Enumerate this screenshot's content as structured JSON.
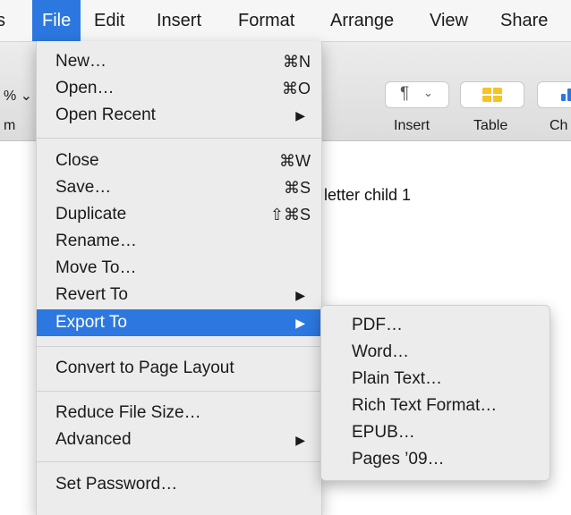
{
  "menubar": {
    "items": [
      "s",
      "File",
      "Edit",
      "Insert",
      "Format",
      "Arrange",
      "View",
      "Share"
    ],
    "active": "File"
  },
  "toolbar": {
    "left_fragment": "% ⌄",
    "left_label": "m",
    "insert_label": "Insert",
    "table_label": "Table",
    "chart_label": "Ch",
    "insert_icon": "¶",
    "insert_chevron": "⌄"
  },
  "document": {
    "text_fragment": "ı letter child 1"
  },
  "file_menu": {
    "items": [
      {
        "label": "New…",
        "shortcut": "⌘N"
      },
      {
        "label": "Open…",
        "shortcut": "⌘O"
      },
      {
        "label": "Open Recent",
        "submenu_arrow": "▶"
      },
      {
        "label": "Close",
        "shortcut": "⌘W"
      },
      {
        "label": "Save…",
        "shortcut": "⌘S"
      },
      {
        "label": "Duplicate",
        "shortcut": "⇧⌘S"
      },
      {
        "label": "Rename…"
      },
      {
        "label": "Move To…"
      },
      {
        "label": "Revert To",
        "submenu_arrow": "▶"
      },
      {
        "label": "Export To",
        "submenu_arrow": "▶",
        "highlighted": true
      },
      {
        "label": "Convert to Page Layout"
      },
      {
        "label": "Reduce File Size…"
      },
      {
        "label": "Advanced",
        "submenu_arrow": "▶"
      },
      {
        "label": "Set Password…"
      }
    ]
  },
  "export_submenu": {
    "items": [
      "PDF…",
      "Word…",
      "Plain Text…",
      "Rich Text Format…",
      "EPUB…",
      "Pages ’09…"
    ]
  },
  "colors": {
    "highlight": "#2c78e0",
    "menu_bg": "#ececec",
    "menubar_bg": "#f6f6f6"
  }
}
